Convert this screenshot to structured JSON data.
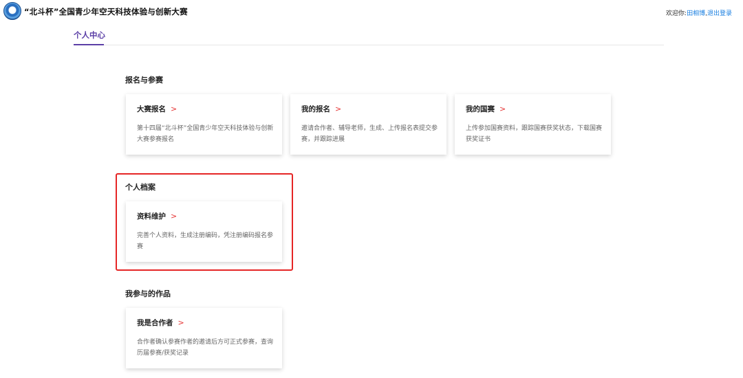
{
  "header": {
    "site_title": "“北斗杯”全国青少年空天科技体验与创新大赛",
    "welcome_text": "欢迎你:",
    "user_name": "田相博",
    "separator": ",",
    "logout_label": "退出登录"
  },
  "tabs": [
    {
      "label": "个人中心",
      "active": true
    }
  ],
  "accent_color": "#5b3fa6",
  "highlight_color": "#e52525",
  "sections": [
    {
      "title": "报名与参赛",
      "cards": [
        {
          "title": "大赛报名",
          "arrow": ">",
          "desc": "第十四届“北斗杯”全国青少年空天科技体验与创新大赛参赛报名"
        },
        {
          "title": "我的报名",
          "arrow": ">",
          "desc": "邀请合作者、辅导老师，生成、上传报名表提交参赛，并跟踪进展"
        },
        {
          "title": "我的国赛",
          "arrow": ">",
          "desc": "上传参加国赛资料，跟踪国赛获奖状态，下载国赛获奖证书"
        }
      ]
    },
    {
      "title": "个人档案",
      "cards": [
        {
          "title": "资料维护",
          "arrow": ">",
          "desc": "完善个人资料，生成注册编码，凭注册编码报名参赛"
        }
      ]
    },
    {
      "title": "我参与的作品",
      "cards": [
        {
          "title": "我是合作者",
          "arrow": ">",
          "desc": "合作者确认参赛作者的邀请后方可正式参赛，查询历届参赛/获奖记录"
        }
      ]
    }
  ]
}
